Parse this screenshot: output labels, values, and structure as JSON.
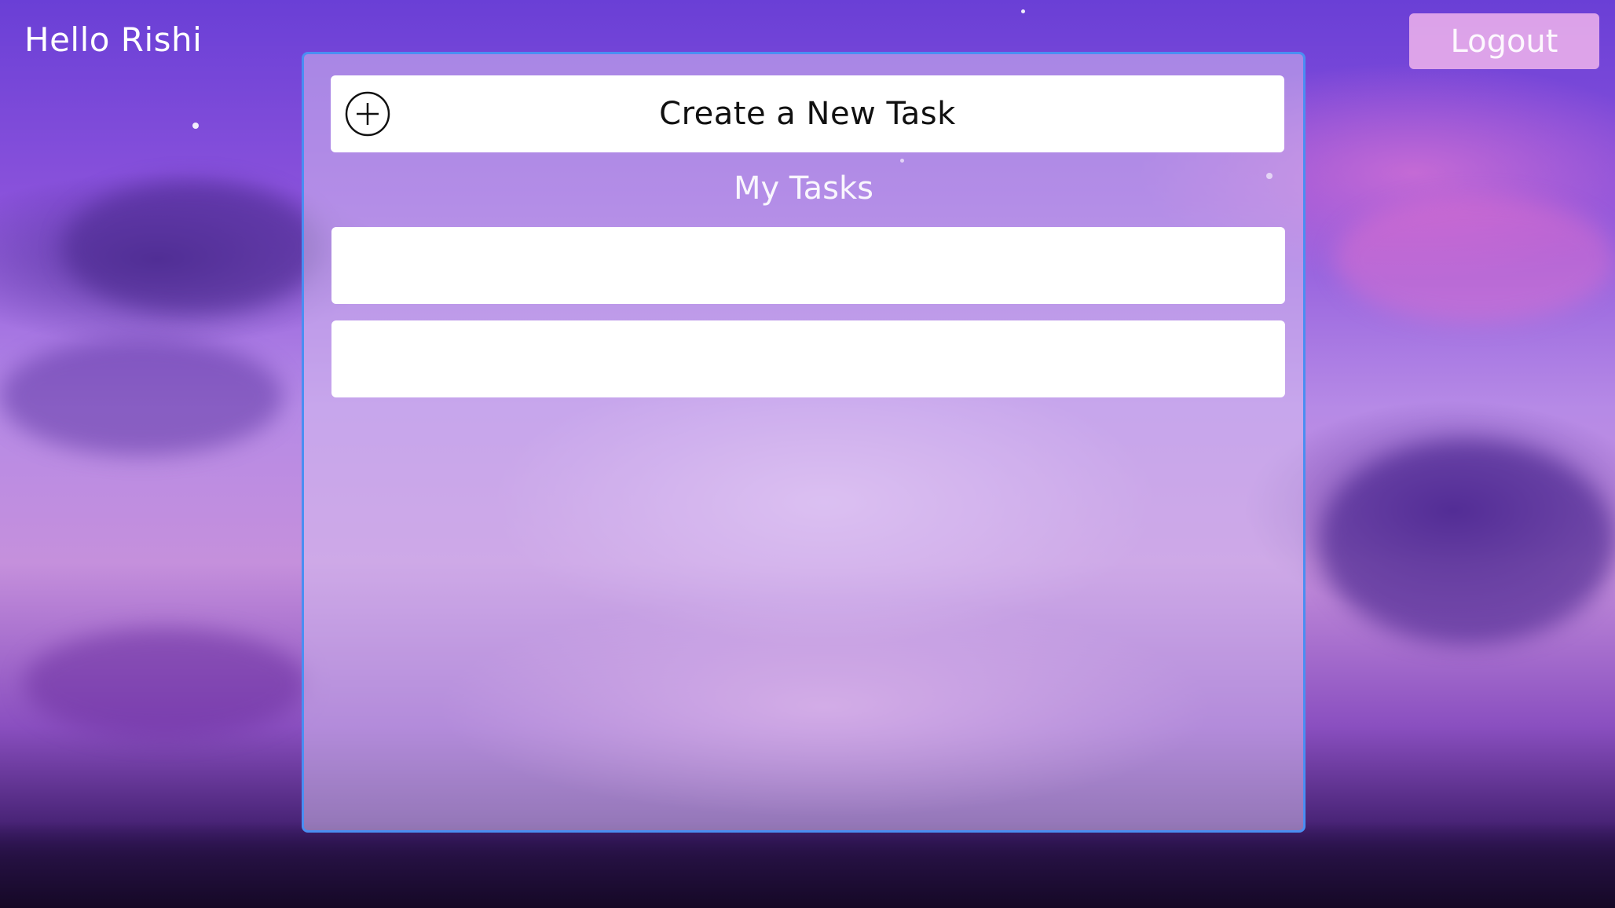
{
  "header": {
    "greeting": "Hello Rishi",
    "logout_label": "Logout"
  },
  "panel": {
    "create_task_label": "Create a New Task",
    "create_task_icon": "plus-circle-icon",
    "section_title": "My Tasks",
    "tasks": [
      {
        "title": ""
      },
      {
        "title": ""
      }
    ]
  },
  "colors": {
    "panel_border": "#4a8ef2",
    "logout_bg": "#f0b4ec",
    "card_bg": "#ffffff"
  }
}
